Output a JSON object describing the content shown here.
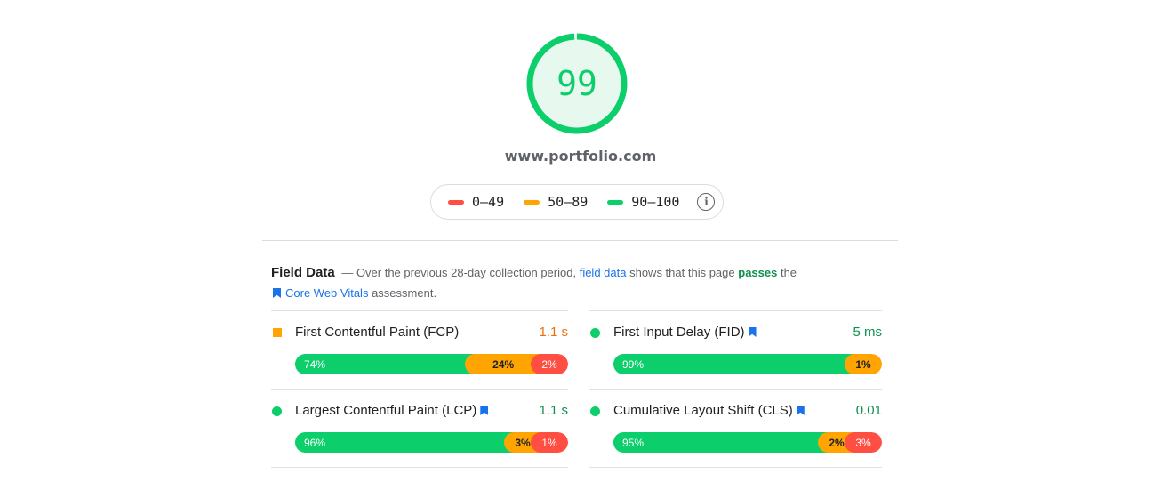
{
  "score": {
    "value": "99",
    "fraction": 0.99,
    "color": "#0cce6b",
    "fill": "#e7f9ee"
  },
  "url": "www.portfolio.com",
  "legend": [
    {
      "label": "0–49",
      "color": "#ff4e42"
    },
    {
      "label": "50–89",
      "color": "#ffa400"
    },
    {
      "label": "90–100",
      "color": "#0cce6b"
    }
  ],
  "legend_info_icon": "info-icon",
  "field_data": {
    "title": "Field Data",
    "dash": "—",
    "text1": "Over the previous 28-day collection period,",
    "link": "field data",
    "text2": "shows that this page",
    "passes": "passes",
    "text3": "the",
    "cwv_link": "Core Web Vitals",
    "text4": "assessment."
  },
  "metrics": [
    {
      "name": "First Contentful Paint (FCP)",
      "value": "1.1 s",
      "value_color": "#e8710a",
      "indicator": "orange-square",
      "bookmark": false,
      "dist": [
        {
          "pct": 74,
          "label": "74%"
        },
        {
          "pct": 24,
          "label": "24%"
        },
        {
          "pct": 2,
          "label": "2%"
        }
      ]
    },
    {
      "name": "First Input Delay (FID)",
      "value": "5 ms",
      "value_color": "#0d904f",
      "indicator": "green-circle",
      "bookmark": true,
      "dist": [
        {
          "pct": 99,
          "label": "99%"
        },
        {
          "pct": 1,
          "label": "1%"
        },
        {
          "pct": 0,
          "label": ""
        }
      ]
    },
    {
      "name": "Largest Contentful Paint (LCP)",
      "value": "1.1 s",
      "value_color": "#0d904f",
      "indicator": "green-circle",
      "bookmark": true,
      "dist": [
        {
          "pct": 96,
          "label": "96%"
        },
        {
          "pct": 3,
          "label": "3%"
        },
        {
          "pct": 1,
          "label": "1%"
        }
      ]
    },
    {
      "name": "Cumulative Layout Shift (CLS)",
      "value": "0.01",
      "value_color": "#0d904f",
      "indicator": "green-circle",
      "bookmark": true,
      "dist": [
        {
          "pct": 95,
          "label": "95%"
        },
        {
          "pct": 2,
          "label": "2%"
        },
        {
          "pct": 3,
          "label": "3%"
        }
      ]
    }
  ]
}
